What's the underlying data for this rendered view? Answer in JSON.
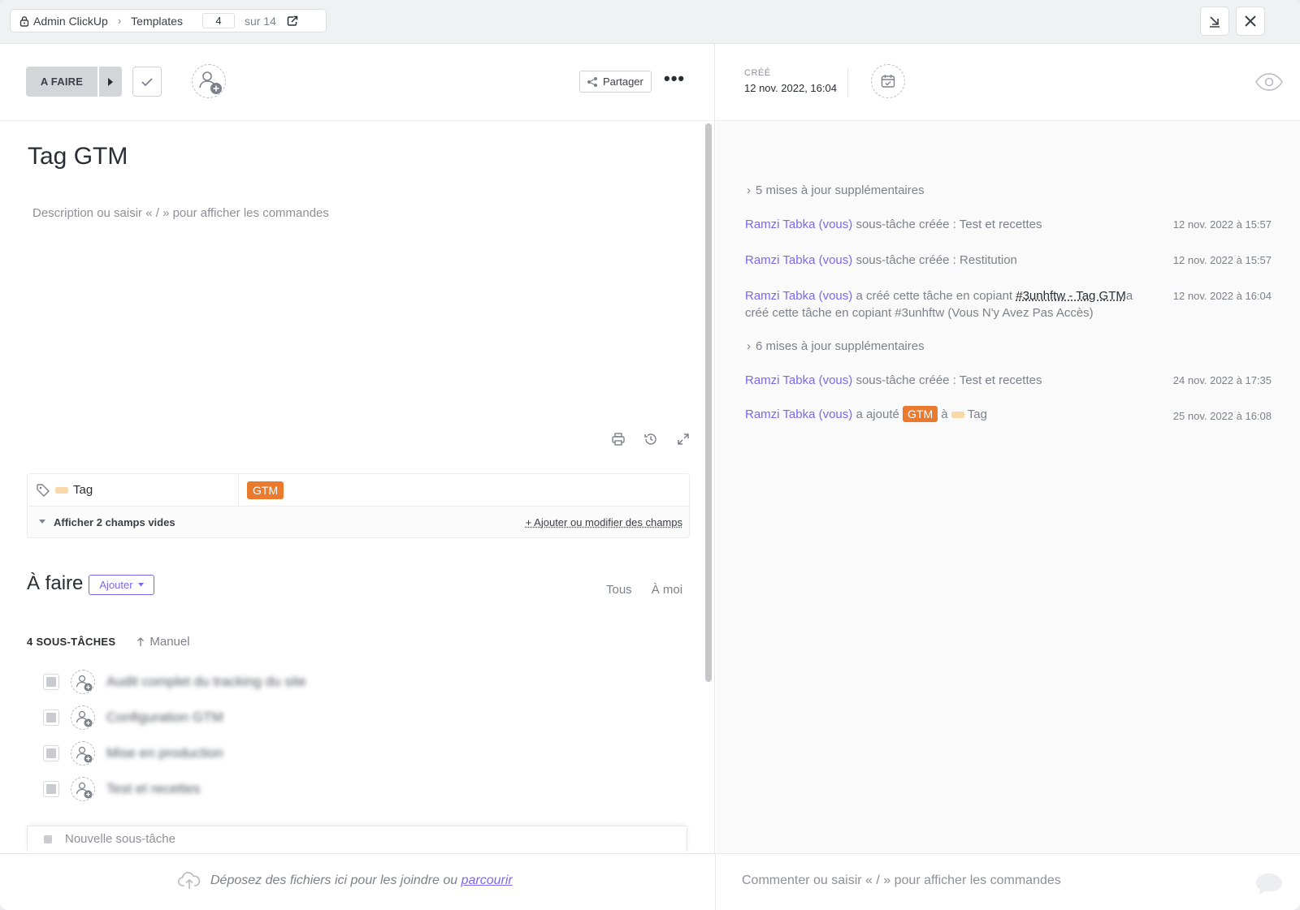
{
  "breadcrumb": {
    "space": "Admin ClickUp",
    "list": "Templates",
    "current_index": "4",
    "total_text": "sur 14"
  },
  "task": {
    "status_label": "A FAIRE",
    "share_label": "Partager",
    "title": "Tag GTM",
    "description_placeholder": "Description ou saisir « / » pour afficher les commandes"
  },
  "fields": {
    "tag_field_name": "Tag",
    "tag_value": "GTM",
    "show_empty": "Afficher 2 champs vides",
    "add_fields": "+ Ajouter ou modifier des champs"
  },
  "todo": {
    "title": "À faire",
    "add_button": "Ajouter",
    "filter_all": "Tous",
    "filter_me": "À moi",
    "subtasks_count": "4 SOUS-TÂCHES",
    "sort_label": "Manuel",
    "subtasks": [
      {
        "name": "Audit complet du tracking du site"
      },
      {
        "name": "Configuration GTM"
      },
      {
        "name": "Mise en production"
      },
      {
        "name": "Test et recettes"
      }
    ],
    "new_subtask_placeholder": "Nouvelle sous-tâche"
  },
  "meta": {
    "created_label": "CRÉÉ",
    "created_value": "12 nov. 2022, 16:04"
  },
  "activity": {
    "more_1": "5 mises à jour supplémentaires",
    "more_2": "6 mises à jour supplémentaires",
    "items": [
      {
        "user": "Ramzi Tabka (vous)",
        "text": " sous-tâche créée : Test et recettes",
        "time": "12 nov. 2022 à 15:57"
      },
      {
        "user": "Ramzi Tabka (vous)",
        "text": " sous-tâche créée : Restitution",
        "time": "12 nov. 2022 à 15:57"
      },
      {
        "user": "Ramzi Tabka (vous)",
        "text_a": " a créé cette tâche en copiant ",
        "link": "#3unhftw - Tag GTM",
        "text_b": "a créé cette tâche en copiant  #3unhftw (Vous N'y Avez Pas Accès)",
        "time": "12 nov. 2022 à 16:04"
      },
      {
        "user": "Ramzi Tabka (vous)",
        "text": " sous-tâche créée : Test et recettes",
        "time": "24 nov. 2022 à 17:35"
      },
      {
        "user": "Ramzi Tabka (vous)",
        "text_a": " a ajouté ",
        "tag": "GTM",
        "text_b": " à ",
        "field": "Tag",
        "time": "25 nov. 2022 à 16:08"
      }
    ]
  },
  "footer": {
    "drop_text": "Déposez des fichiers ici pour les joindre ou ",
    "browse_link": "parcourir",
    "comment_placeholder": "Commenter ou saisir « / » pour afficher les commandes"
  },
  "colors": {
    "accent": "#7b68ee",
    "tag_orange": "#ea7b2e",
    "status_gray": "#d4d5d8"
  }
}
